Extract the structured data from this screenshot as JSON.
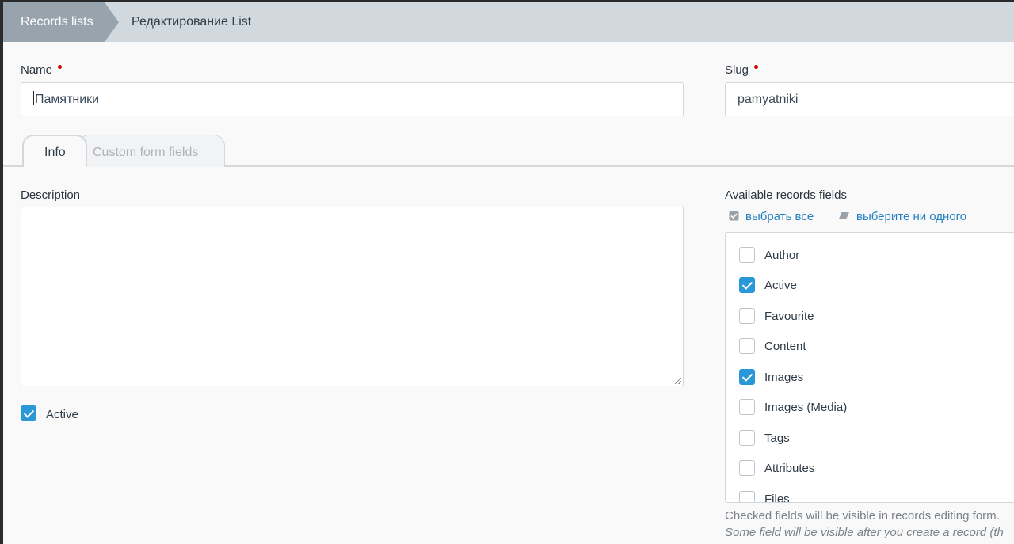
{
  "breadcrumb": {
    "first": "Records lists",
    "second": "Редактирование List"
  },
  "name_field": {
    "label": "Name",
    "value": "Памятники"
  },
  "slug_field": {
    "label": "Slug",
    "value": "pamyatniki"
  },
  "tabs": [
    {
      "label": "Info",
      "active": true
    },
    {
      "label": "Custom form fields",
      "active": false
    }
  ],
  "description": {
    "label": "Description",
    "value": ""
  },
  "active_checkbox": {
    "label": "Active",
    "checked": true
  },
  "available_fields": {
    "label": "Available records fields",
    "select_all": "выбрать все",
    "select_none": "выберите ни одного",
    "items": [
      {
        "label": "Author",
        "checked": false
      },
      {
        "label": "Active",
        "checked": true
      },
      {
        "label": "Favourite",
        "checked": false
      },
      {
        "label": "Content",
        "checked": false
      },
      {
        "label": "Images",
        "checked": true
      },
      {
        "label": "Images (Media)",
        "checked": false
      },
      {
        "label": "Tags",
        "checked": false
      },
      {
        "label": "Attributes",
        "checked": false
      },
      {
        "label": "Files",
        "checked": false
      }
    ],
    "help_1": "Checked fields will be visible in records editing form.",
    "help_2": "Some field will be visible after you create a record (th"
  },
  "colors": {
    "accent": "#2a98d6",
    "link": "#2381c1",
    "required": "#d00000"
  }
}
